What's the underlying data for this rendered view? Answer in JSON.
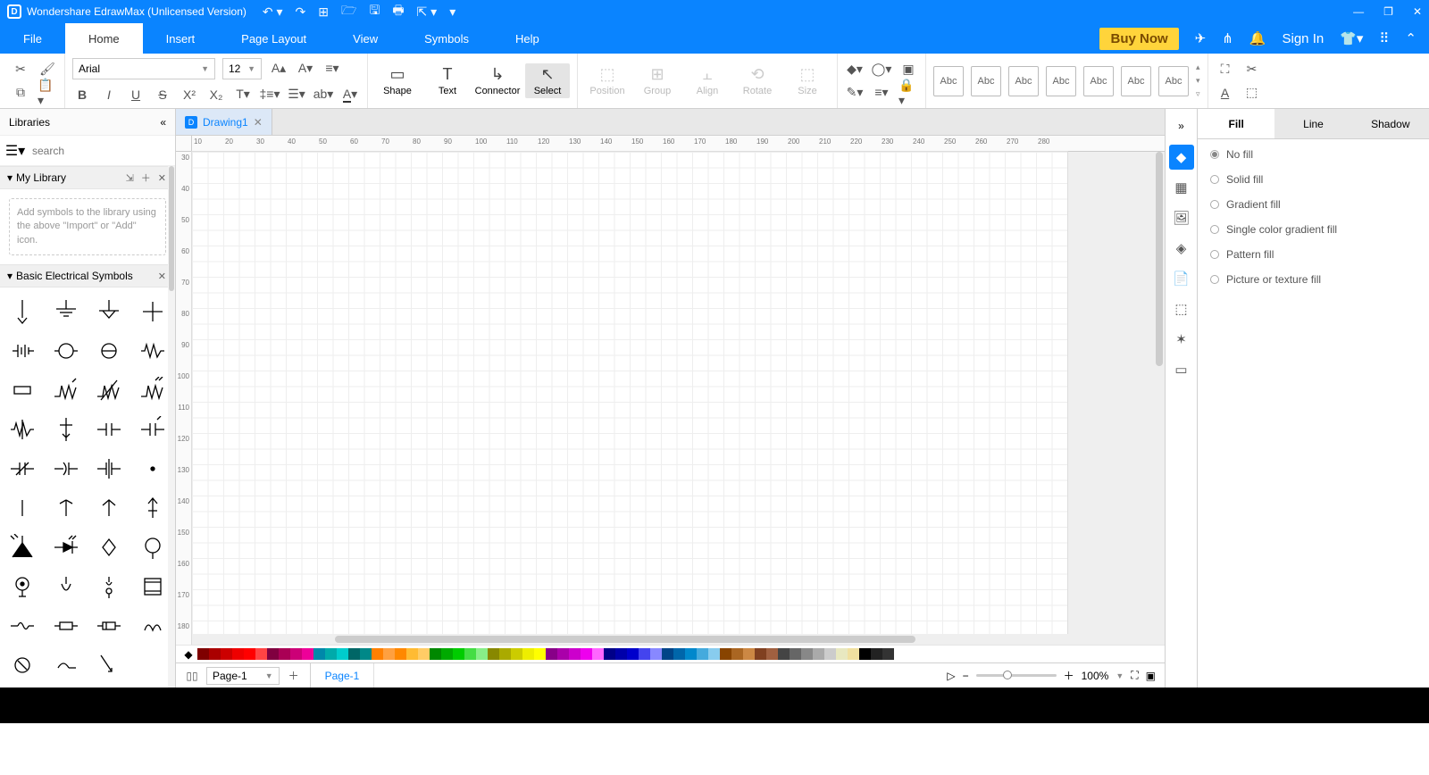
{
  "title": "Wondershare EdrawMax (Unlicensed Version)",
  "menu": {
    "file": "File",
    "home": "Home",
    "insert": "Insert",
    "page_layout": "Page Layout",
    "view": "View",
    "symbols": "Symbols",
    "help": "Help"
  },
  "topright": {
    "buy": "Buy Now",
    "signin": "Sign In"
  },
  "ribbon": {
    "font": "Arial",
    "size": "12",
    "shape": "Shape",
    "text": "Text",
    "connector": "Connector",
    "select": "Select",
    "position": "Position",
    "group": "Group",
    "align": "Align",
    "rotate": "Rotate",
    "size_lbl": "Size",
    "style": "Abc"
  },
  "libs": {
    "title": "Libraries",
    "search_ph": "search",
    "my_library": "My Library",
    "my_library_hint": "Add symbols to the library using the above \"Import\" or \"Add\" icon.",
    "basic": "Basic Electrical Symbols"
  },
  "doc": {
    "tab": "Drawing1"
  },
  "ruler_h": [
    10,
    20,
    30,
    40,
    50,
    60,
    70,
    80,
    90,
    100,
    110,
    120,
    130,
    140,
    150,
    160,
    170,
    180,
    190,
    200,
    210,
    220,
    230,
    240,
    250,
    260,
    270,
    280
  ],
  "ruler_v": [
    30,
    40,
    50,
    60,
    70,
    80,
    90,
    100,
    110,
    120,
    130,
    140,
    150,
    160,
    170,
    180
  ],
  "props": {
    "tabs": {
      "fill": "Fill",
      "line": "Line",
      "shadow": "Shadow"
    },
    "opts": [
      "No fill",
      "Solid fill",
      "Gradient fill",
      "Single color gradient fill",
      "Pattern fill",
      "Picture or texture fill"
    ],
    "selected": 0
  },
  "pagenav": {
    "dropdown": "Page-1",
    "tab": "Page-1",
    "zoom": "100%"
  },
  "colors": [
    "#7f0000",
    "#a00",
    "#c00",
    "#e00",
    "#f00",
    "#f44",
    "#800040",
    "#a05",
    "#c07",
    "#e09",
    "#08a",
    "#0aa",
    "#0cc",
    "#066",
    "#088",
    "#ff8000",
    "#ffa040",
    "#f80",
    "#fb3",
    "#fc6",
    "#080",
    "#0a0",
    "#0c0",
    "#4d4",
    "#8e8",
    "#880",
    "#aa0",
    "#cc0",
    "#ee0",
    "#ff0",
    "#808",
    "#a0a",
    "#c0c",
    "#e0e",
    "#f6f",
    "#008",
    "#00a",
    "#00c",
    "#44e",
    "#88f",
    "#048",
    "#06a",
    "#08c",
    "#4ad",
    "#8ce",
    "#840",
    "#a62",
    "#c84",
    "#804020",
    "#a06040",
    "#444",
    "#666",
    "#888",
    "#aaa",
    "#ccc",
    "#e8e8c0",
    "#f0e0a0",
    "#000",
    "#222",
    "#333"
  ]
}
